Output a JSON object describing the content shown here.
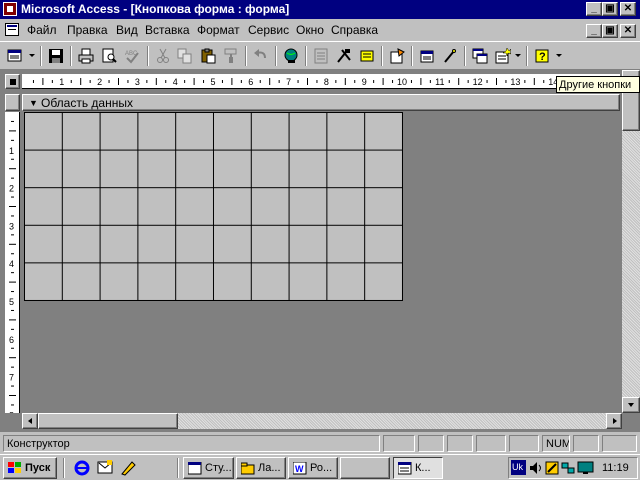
{
  "window": {
    "title": "Microsoft Access - [Кнопкова форма : форма]",
    "min_glyph": "_",
    "max_glyph": "▣",
    "close_glyph": "✕"
  },
  "menu": [
    "Файл",
    "Правка",
    "Вид",
    "Вставка",
    "Формат",
    "Сервис",
    "Окно",
    "Справка"
  ],
  "toolbar": {
    "buttons": [
      "form-view-icon",
      "save-icon",
      "print-icon",
      "print-preview-icon",
      "spelling-icon",
      "cut-icon",
      "copy-icon",
      "paste-icon",
      "format-painter-icon",
      "undo-icon",
      "insert-hyperlink-icon",
      "field-list-icon",
      "toolbox-icon",
      "autoformat-icon",
      "code-icon",
      "properties-icon",
      "build-icon",
      "database-window-icon",
      "new-object-icon",
      "help-icon"
    ],
    "tooltip": "Другие кнопки"
  },
  "ruler": {
    "h_labels": [
      "1",
      "2",
      "3",
      "4",
      "5",
      "6",
      "7",
      "8",
      "9",
      "10",
      "11",
      "12",
      "13",
      "14"
    ],
    "v_labels": [
      "1",
      "2",
      "3",
      "4",
      "5",
      "6",
      "7",
      "8"
    ]
  },
  "section": {
    "label": "Область данных"
  },
  "grid": {
    "columns": 10,
    "rows": 5
  },
  "status": {
    "mode": "Конструктор",
    "num": "NUM"
  },
  "taskbar": {
    "start_label": "Пуск",
    "tasks": [
      "Сту...",
      "Ла...",
      "Ро...",
      "",
      "К..."
    ],
    "tray_lang": "Uk",
    "clock": "11:19"
  },
  "colors": {
    "titlebar": "#000080",
    "workspace": "#808080",
    "face": "#c0c0c0",
    "tooltip": "#ffffe1"
  }
}
